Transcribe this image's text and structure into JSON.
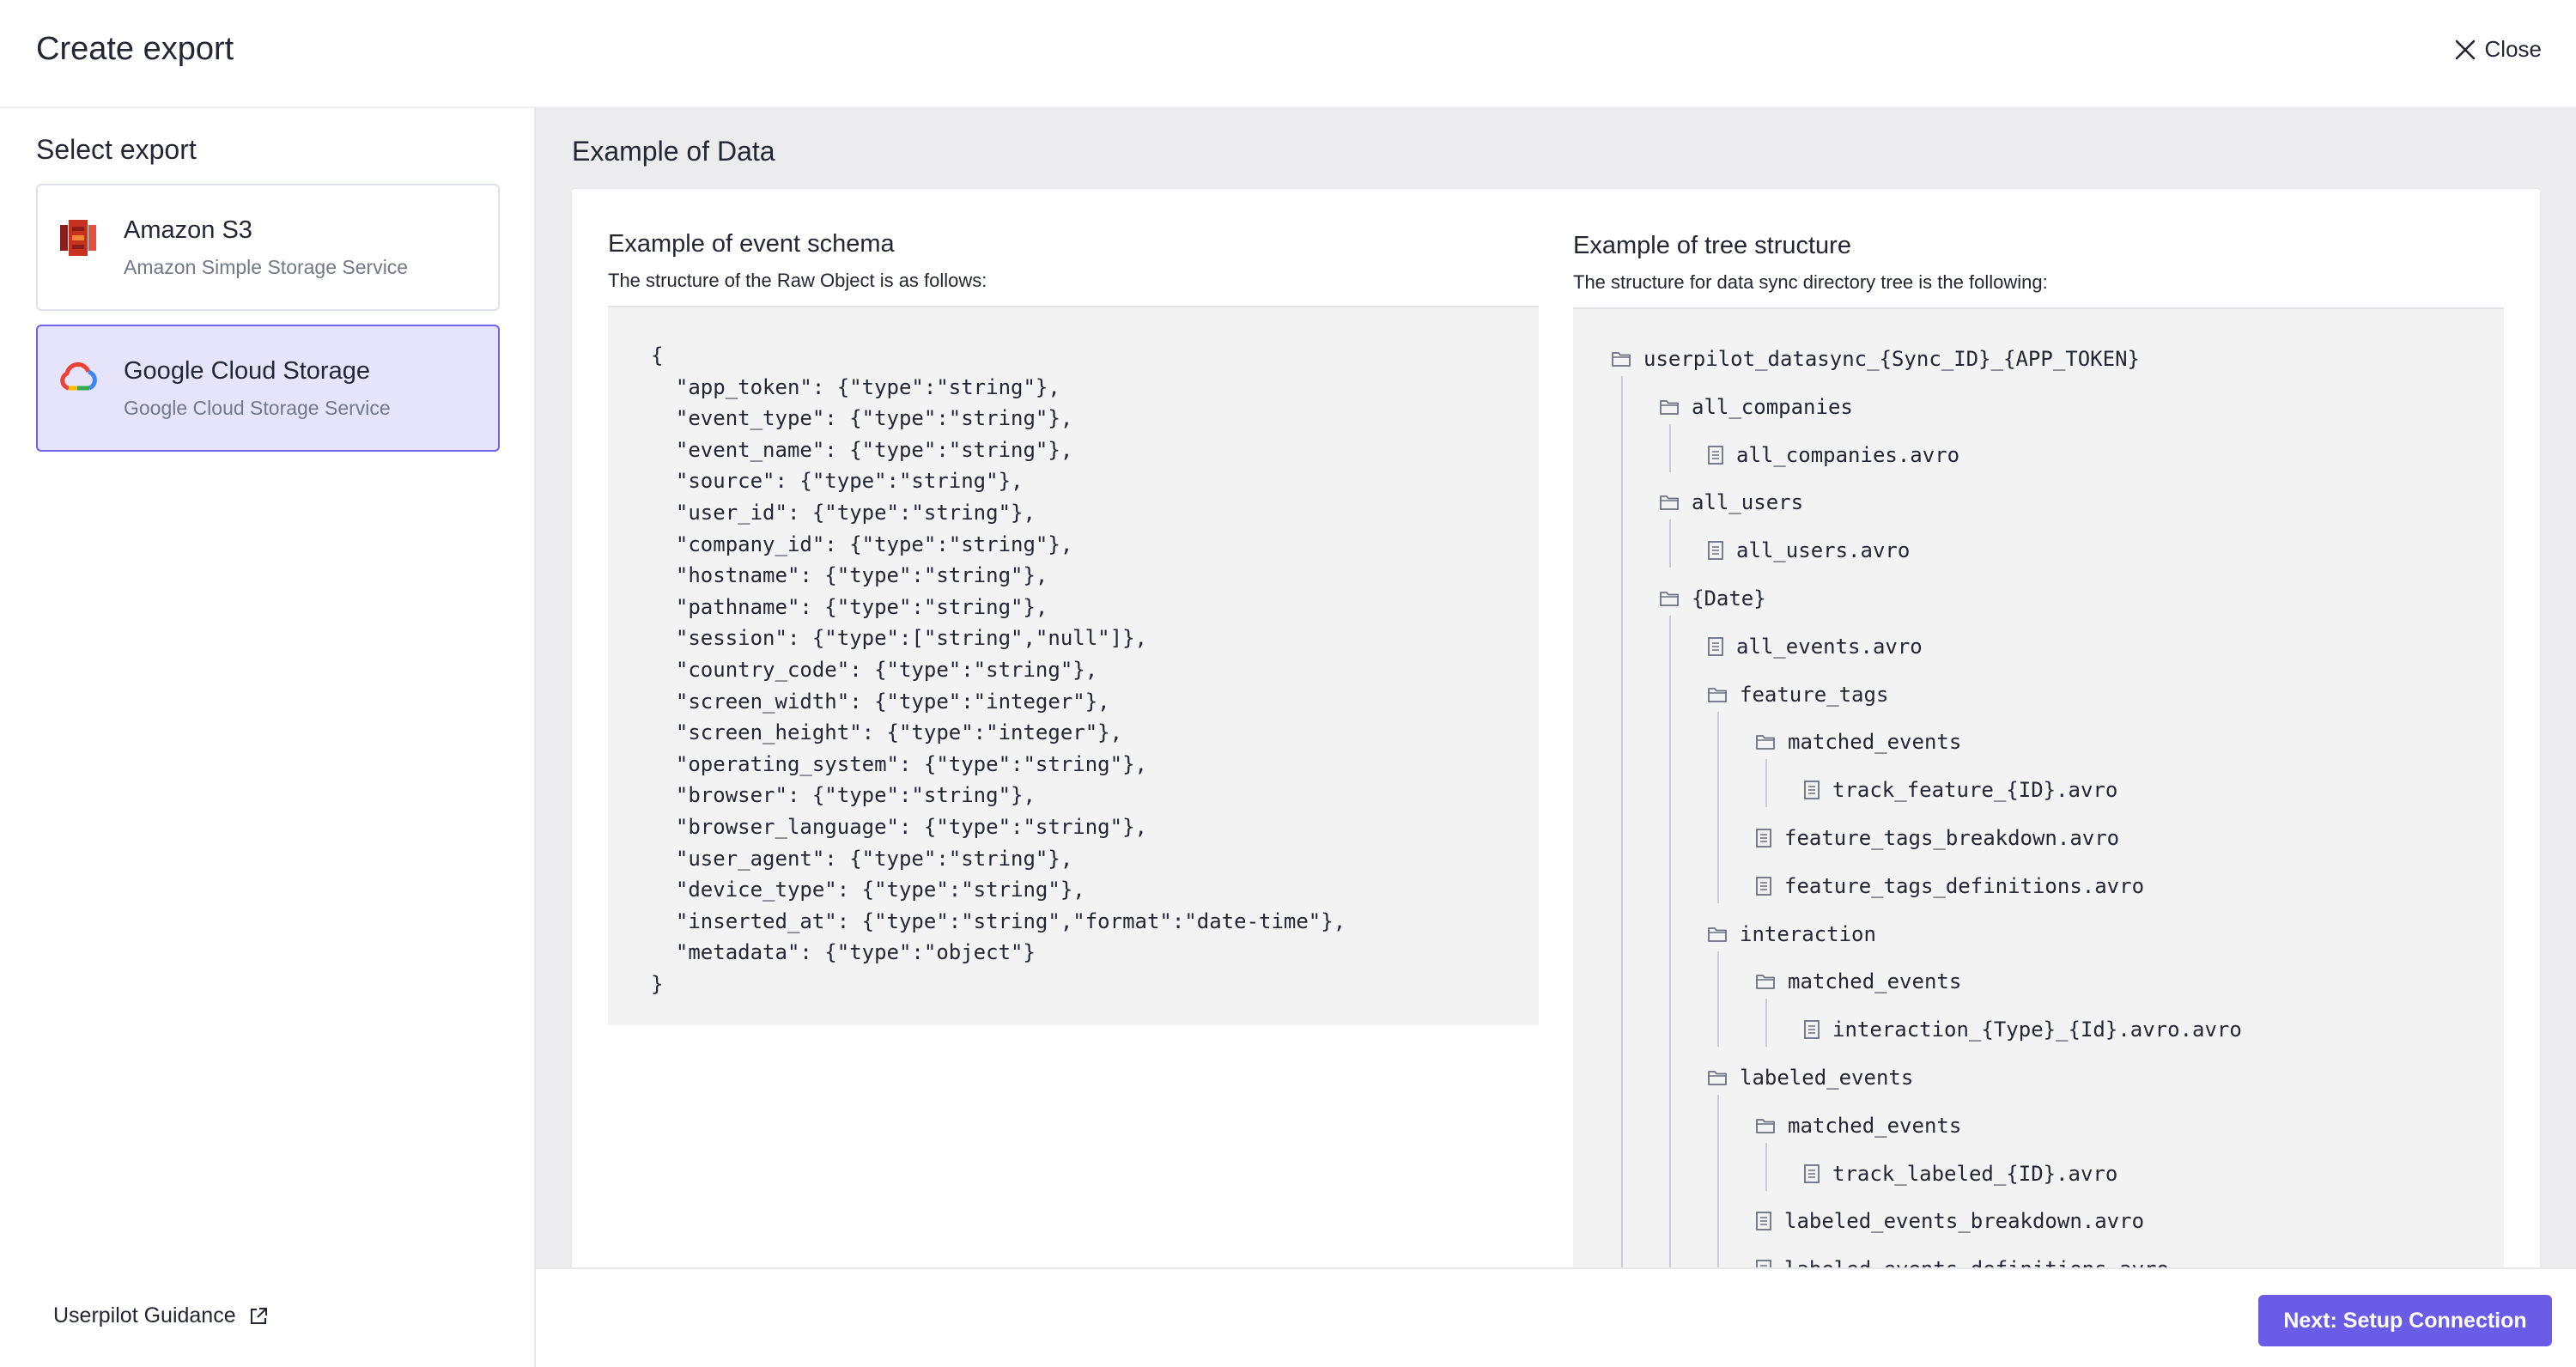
{
  "header": {
    "title": "Create export",
    "close_label": "Close"
  },
  "sidebar": {
    "title": "Select export",
    "options": [
      {
        "name": "Amazon S3",
        "description": "Amazon Simple Storage Service",
        "icon": "amazon-s3-icon",
        "selected": false
      },
      {
        "name": "Google Cloud Storage",
        "description": "Google Cloud Storage Service",
        "icon": "google-cloud-icon",
        "selected": true
      }
    ],
    "guidance_label": "Userpilot Guidance"
  },
  "main": {
    "title": "Example of Data",
    "schema": {
      "title": "Example of event schema",
      "subtitle": "The structure of the Raw Object is as follows:",
      "lines": [
        "{",
        "  \"app_token\": {\"type\":\"string\"},",
        "  \"event_type\": {\"type\":\"string\"},",
        "  \"event_name\": {\"type\":\"string\"},",
        "  \"source\": {\"type\":\"string\"},",
        "  \"user_id\": {\"type\":\"string\"},",
        "  \"company_id\": {\"type\":\"string\"},",
        "  \"hostname\": {\"type\":\"string\"},",
        "  \"pathname\": {\"type\":\"string\"},",
        "  \"session\": {\"type\":[\"string\",\"null\"]},",
        "  \"country_code\": {\"type\":\"string\"},",
        "  \"screen_width\": {\"type\":\"integer\"},",
        "  \"screen_height\": {\"type\":\"integer\"},",
        "  \"operating_system\": {\"type\":\"string\"},",
        "  \"browser\": {\"type\":\"string\"},",
        "  \"browser_language\": {\"type\":\"string\"},",
        "  \"user_agent\": {\"type\":\"string\"},",
        "  \"device_type\": {\"type\":\"string\"},",
        "  \"inserted_at\": {\"type\":\"string\",\"format\":\"date-time\"},",
        "  \"metadata\": {\"type\":\"object\"}",
        "}"
      ]
    },
    "tree": {
      "title": "Example of tree structure",
      "subtitle": "The structure for data sync directory tree is the following:",
      "items": [
        {
          "label": "userpilot_datasync_{Sync_ID}_{APP_TOKEN}",
          "kind": "folder",
          "depth": 0
        },
        {
          "label": "all_companies",
          "kind": "folder",
          "depth": 1
        },
        {
          "label": "all_companies.avro",
          "kind": "file",
          "depth": 2
        },
        {
          "label": "all_users",
          "kind": "folder",
          "depth": 1
        },
        {
          "label": "all_users.avro",
          "kind": "file",
          "depth": 2
        },
        {
          "label": "{Date}",
          "kind": "folder",
          "depth": 1
        },
        {
          "label": "all_events.avro",
          "kind": "file",
          "depth": 2
        },
        {
          "label": "feature_tags",
          "kind": "folder",
          "depth": 2
        },
        {
          "label": "matched_events",
          "kind": "folder",
          "depth": 3
        },
        {
          "label": "track_feature_{ID}.avro",
          "kind": "file",
          "depth": 4
        },
        {
          "label": "feature_tags_breakdown.avro",
          "kind": "file",
          "depth": 3
        },
        {
          "label": "feature_tags_definitions.avro",
          "kind": "file",
          "depth": 3
        },
        {
          "label": "interaction",
          "kind": "folder",
          "depth": 2
        },
        {
          "label": "matched_events",
          "kind": "folder",
          "depth": 3
        },
        {
          "label": "interaction_{Type}_{Id}.avro.avro",
          "kind": "file",
          "depth": 4
        },
        {
          "label": "labeled_events",
          "kind": "folder",
          "depth": 2
        },
        {
          "label": "matched_events",
          "kind": "folder",
          "depth": 3
        },
        {
          "label": "track_labeled_{ID}.avro",
          "kind": "file",
          "depth": 4
        },
        {
          "label": "labeled_events_breakdown.avro",
          "kind": "file",
          "depth": 3
        },
        {
          "label": "labeled_events_definitions.avro",
          "kind": "file",
          "depth": 3
        }
      ]
    }
  },
  "footer": {
    "next_label": "Next: Setup Connection"
  },
  "colors": {
    "accent": "#6b5ce7",
    "selected_bg": "#e6e4fb",
    "selected_border": "#6f63e8"
  }
}
